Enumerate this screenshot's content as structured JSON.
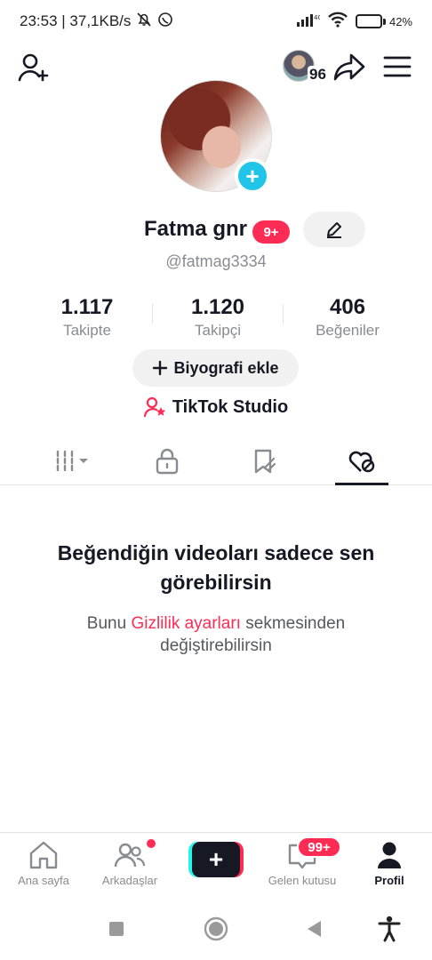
{
  "status_bar": {
    "time_speed": "23:53 | 37,1KB/s",
    "battery_pct": "42%",
    "battery_level": 0.42
  },
  "top_bar": {
    "visitor_count": "96"
  },
  "profile": {
    "display_name": "Fatma gnr",
    "badge": "9+",
    "username": "@fatmag3334"
  },
  "stats": [
    {
      "value": "1.117",
      "label": "Takipte"
    },
    {
      "value": "1.120",
      "label": "Takipçi"
    },
    {
      "value": "406",
      "label": "Beğeniler"
    }
  ],
  "actions": {
    "bio_label": "Biyografi ekle",
    "studio_label": "TikTok Studio"
  },
  "tabs": {
    "icons": [
      "videos-grid-icon",
      "lock-icon",
      "saved-icon",
      "liked-icon"
    ],
    "active_index": 3
  },
  "empty_state": {
    "title": "Beğendiğin videoları sadece sen görebilirsin",
    "desc_before": "Bunu ",
    "desc_link": "Gizlilik ayarları",
    "desc_after": " sekmesinden değiştirebilirsin"
  },
  "bottom_nav": {
    "home": "Ana sayfa",
    "friends": "Arkadaşlar",
    "inbox": "Gelen kutusu",
    "inbox_badge": "99+",
    "profile": "Profil"
  },
  "colors": {
    "accent": "#fe2c55",
    "cyan": "#20c5e8",
    "text": "#161823",
    "muted": "#8a8b91"
  }
}
